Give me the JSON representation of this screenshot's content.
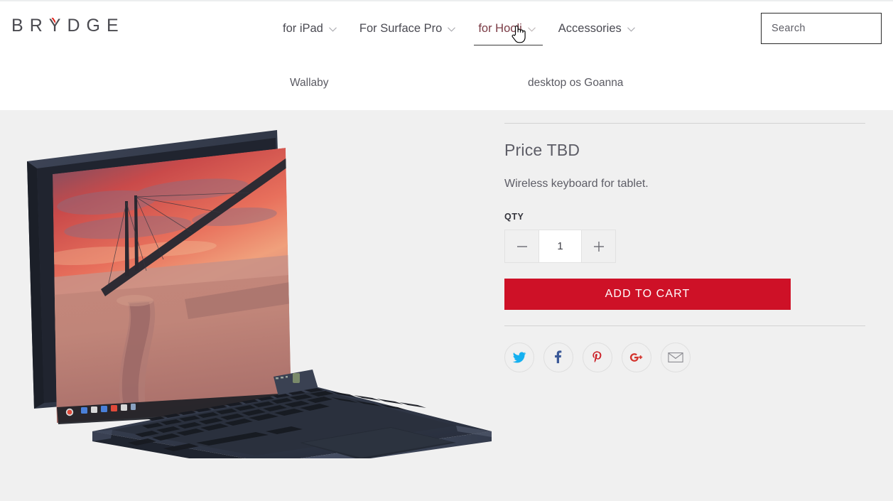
{
  "brand": {
    "logo_text": "BRYDGE",
    "logo_letters": [
      "B",
      "R",
      "Y",
      "D",
      "G",
      "E"
    ],
    "accent_color": "#e2231a",
    "logo_color": "#4a4a50"
  },
  "header": {
    "nav": [
      {
        "label": "for iPad",
        "active": false,
        "has_chevron": true
      },
      {
        "label": "For Surface Pro",
        "active": false,
        "has_chevron": true
      },
      {
        "label": "for Hooli",
        "active": true,
        "has_chevron": true
      },
      {
        "label": "Accessories",
        "active": false,
        "has_chevron": true
      }
    ],
    "active_nav_color": "#7a3a44",
    "submenu": [
      {
        "label": "Wallaby"
      },
      {
        "label": "desktop os Goanna"
      }
    ],
    "search": {
      "placeholder": "Search",
      "value": "",
      "icon": "search-icon"
    }
  },
  "product": {
    "price": "Price TBD",
    "description": "Wireless keyboard for tablet.",
    "qty_label": "QTY",
    "qty_value": "1",
    "decrement_icon": "minus-icon",
    "increment_icon": "plus-icon",
    "add_to_cart_label": "ADD TO CART",
    "add_to_cart_color": "#ce1127",
    "image_alt": "Navy laptop with detachable keyboard, sunset bridge wallpaper on screen"
  },
  "social": [
    {
      "name": "twitter",
      "label": "Twitter",
      "color": "#15b0f0"
    },
    {
      "name": "facebook",
      "label": "Facebook",
      "color": "#3b5998"
    },
    {
      "name": "pinterest",
      "label": "Pinterest",
      "color": "#cb2027"
    },
    {
      "name": "googleplus",
      "label": "Google Plus",
      "color": "#d3322b"
    },
    {
      "name": "email",
      "label": "Email",
      "color": "#8a8a90"
    }
  ],
  "cursor": {
    "type": "pointer-hand"
  },
  "theme": {
    "page_background": "#ffffff",
    "content_background": "#f0f0f0",
    "divider": "#d3d3d3",
    "text": "#5d5d66"
  }
}
